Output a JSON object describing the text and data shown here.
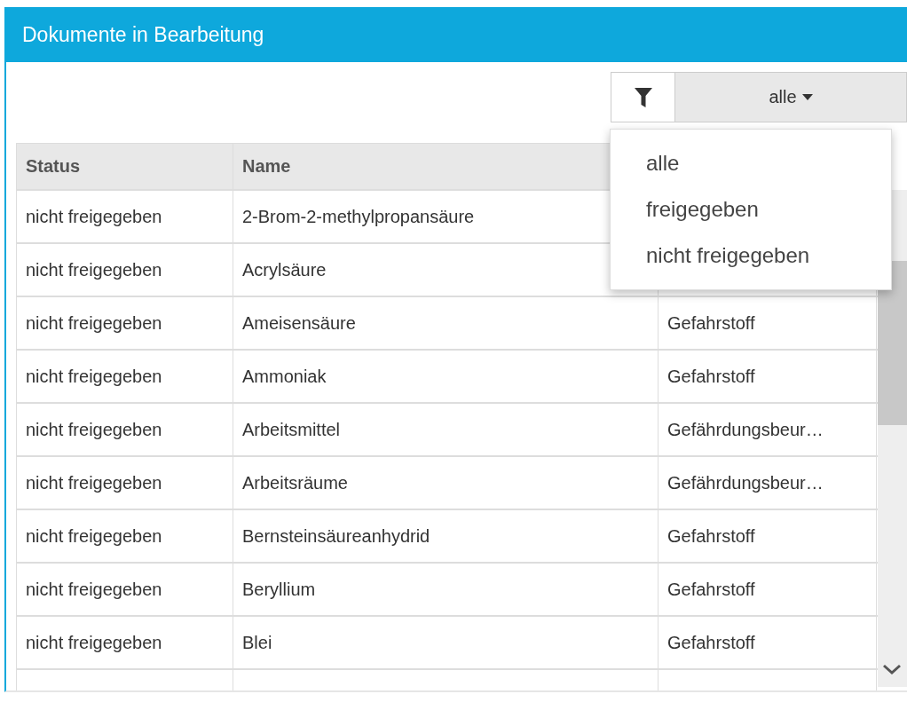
{
  "panel": {
    "title": "Dokumente in Bearbeitung"
  },
  "filter": {
    "value": "alle",
    "menu_open": true,
    "options": [
      "alle",
      "freigegeben",
      "nicht freigegeben"
    ]
  },
  "table": {
    "columns": [
      "Status",
      "Name"
    ],
    "rows": [
      {
        "status": "nicht freigegeben",
        "name": "2-Brom-2-methylpropansäure",
        "column_3": ""
      },
      {
        "status": "nicht freigegeben",
        "name": "Acrylsäure",
        "column_3": ""
      },
      {
        "status": "nicht freigegeben",
        "name": "Ameisensäure",
        "column_3": "Gefahrstoff"
      },
      {
        "status": "nicht freigegeben",
        "name": "Ammoniak",
        "column_3": "Gefahrstoff"
      },
      {
        "status": "nicht freigegeben",
        "name": "Arbeitsmittel",
        "column_3": "Gefährdungsbeur…"
      },
      {
        "status": "nicht freigegeben",
        "name": "Arbeitsräume",
        "column_3": "Gefährdungsbeur…"
      },
      {
        "status": "nicht freigegeben",
        "name": "Bernsteinsäureanhydrid",
        "column_3": "Gefahrstoff"
      },
      {
        "status": "nicht freigegeben",
        "name": "Beryllium",
        "column_3": "Gefahrstoff"
      },
      {
        "status": "nicht freigegeben",
        "name": "Blei",
        "column_3": "Gefahrstoff"
      }
    ]
  }
}
